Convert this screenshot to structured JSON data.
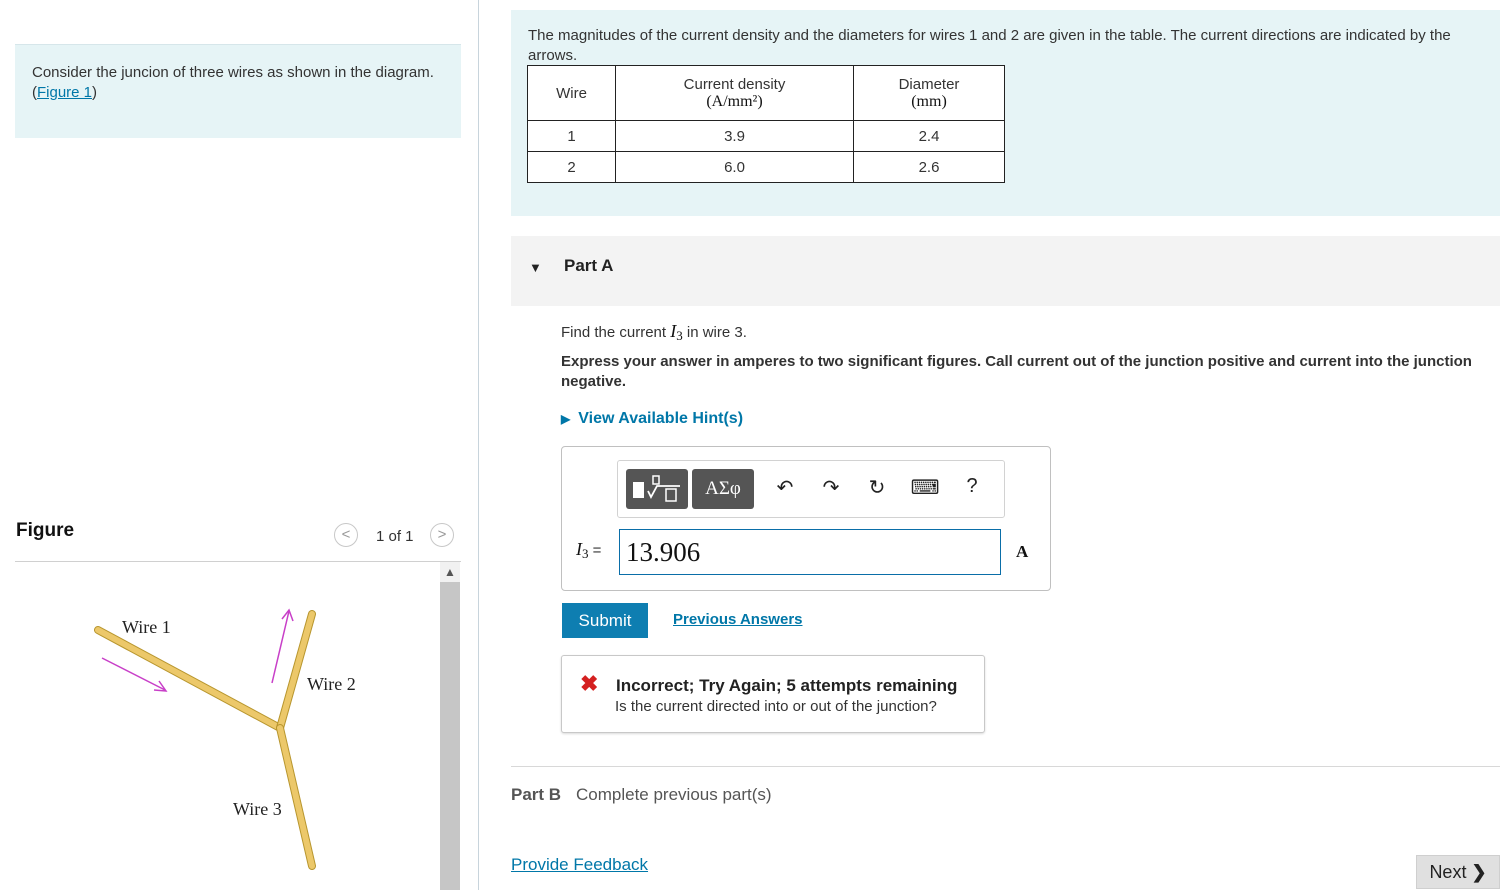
{
  "intro": {
    "text": "Consider the juncion of three wires as shown in the diagram. (",
    "figure_link": "Figure 1",
    "close": ")"
  },
  "figure_panel": {
    "title": "Figure",
    "counter": "1 of 1",
    "prev_icon": "chevron-left-icon",
    "next_icon": "chevron-right-icon",
    "wire_labels": [
      "Wire 1",
      "Wire 2",
      "Wire 3"
    ],
    "colors": {
      "wire": "#e8c66a",
      "wire_edge": "#b8962e",
      "arrow": "#c83fc8"
    }
  },
  "problem": {
    "text": "The magnitudes of the current density and the diameters for wires 1 and 2 are given in the table. The current directions are indicated by the arrows.",
    "table": {
      "headers": [
        {
          "label": "Wire",
          "unit": ""
        },
        {
          "label": "Current density",
          "unit": "(A/mm²)"
        },
        {
          "label": "Diameter",
          "unit": "(mm)"
        }
      ],
      "rows": [
        [
          "1",
          "3.9",
          "2.4"
        ],
        [
          "2",
          "6.0",
          "2.6"
        ]
      ]
    }
  },
  "partA": {
    "title": "Part A",
    "question_prefix": "Find the current ",
    "question_var": "I",
    "question_sub": "3",
    "question_suffix": " in wire 3.",
    "instructions": "Express your answer in amperes to two significant figures. Call current out of the junction positive and current into the junction negative.",
    "hints": "View Available Hint(s)",
    "toolbar": {
      "template_icon": "sqrt-template-icon",
      "greek_label": "ΑΣφ",
      "undo_icon": "↶",
      "redo_icon": "↷",
      "reset_icon": "↻",
      "keyboard_icon": "⌨",
      "help_label": "?"
    },
    "answer_label_var": "I",
    "answer_label_sub": "3",
    "answer_label_eq": " =",
    "answer_value": "13.906",
    "answer_unit": "A",
    "submit": "Submit",
    "previous_answers": "Previous Answers",
    "feedback_icon": "✖",
    "feedback_title": "Incorrect; Try Again; 5 attempts remaining",
    "feedback_message": "Is the current directed into or out of the junction?"
  },
  "partB": {
    "label": "Part B",
    "status": "Complete previous part(s)"
  },
  "footer": {
    "feedback_link": "Provide Feedback",
    "next": "Next"
  }
}
